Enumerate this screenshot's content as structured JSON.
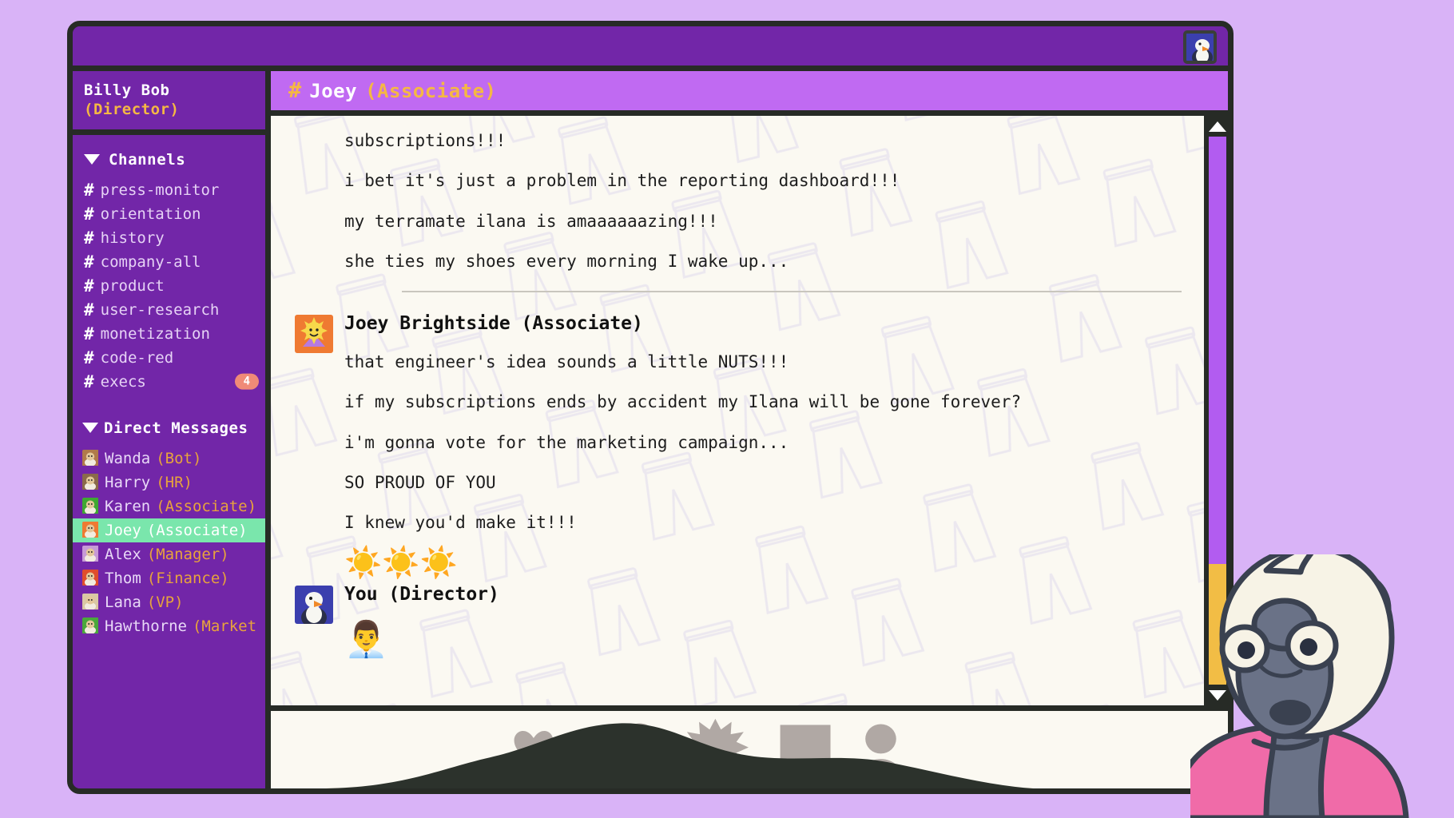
{
  "theme": {
    "page_bg": "#d9b3f7",
    "window_bg": "#7226a8",
    "border": "#272b26",
    "sidebar_purple": "#7226a8",
    "header_purple": "#c06af2",
    "accent_orange": "#f5b843",
    "active_green": "#7ae6ac",
    "badge_coral": "#f08a77",
    "message_bg": "#fbf9f2",
    "scrollbar_thumb": "#b25cf0",
    "scrollbar_thumb_alt": "#f2bd45"
  },
  "titlebar": {
    "avatar_icon": "seagull-avatar-icon"
  },
  "sidebar": {
    "user": {
      "name": "Billy Bob",
      "role": "(Director)"
    },
    "channels_section": {
      "label": "Channels",
      "caret_icon": "caret-down-icon",
      "items": [
        {
          "hash": "#",
          "name": "press-monitor",
          "badge": ""
        },
        {
          "hash": "#",
          "name": "orientation",
          "badge": ""
        },
        {
          "hash": "#",
          "name": "history",
          "badge": ""
        },
        {
          "hash": "#",
          "name": "company-all",
          "badge": ""
        },
        {
          "hash": "#",
          "name": "product",
          "badge": ""
        },
        {
          "hash": "#",
          "name": "user-research",
          "badge": ""
        },
        {
          "hash": "#",
          "name": "monetization",
          "badge": ""
        },
        {
          "hash": "#",
          "name": "code-red",
          "badge": ""
        },
        {
          "hash": "#",
          "name": "execs",
          "badge": "4"
        }
      ]
    },
    "dm_section": {
      "label": "Direct Messages",
      "caret_icon": "caret-down-icon",
      "items": [
        {
          "name": "Wanda",
          "role": "(Bot)",
          "avatar_icon": "wanda-avatar-icon",
          "avatar_bg": "#b07a4a",
          "active": false
        },
        {
          "name": "Harry",
          "role": "(HR)",
          "avatar_icon": "harry-avatar-icon",
          "avatar_bg": "#8a6a4a",
          "active": false
        },
        {
          "name": "Karen",
          "role": "(Associate)",
          "avatar_icon": "karen-avatar-icon",
          "avatar_bg": "#3fa832",
          "active": false
        },
        {
          "name": "Joey",
          "role": "(Associate)",
          "avatar_icon": "joey-avatar-icon",
          "avatar_bg": "#ef7a32",
          "active": true
        },
        {
          "name": "Alex",
          "role": "(Manager)",
          "avatar_icon": "alex-avatar-icon",
          "avatar_bg": "#c79ad6",
          "active": false
        },
        {
          "name": "Thom",
          "role": "(Finance)",
          "avatar_icon": "thom-avatar-icon",
          "avatar_bg": "#e04d2c",
          "active": false
        },
        {
          "name": "Lana",
          "role": "(VP)",
          "avatar_icon": "lana-avatar-icon",
          "avatar_bg": "#d9c8a4",
          "active": false
        },
        {
          "name": "Hawthorne",
          "role": "(Market",
          "avatar_icon": "hawthorne-avatar-icon",
          "avatar_bg": "#4aa83c",
          "active": false
        }
      ]
    }
  },
  "channel_header": {
    "hash": "#",
    "name": "Joey",
    "role": "(Associate)"
  },
  "conversation": {
    "leading_lines": [
      "subscriptions!!!",
      "i bet it's just a problem in the reporting dashboard!!!",
      "my terramate ilana is amaaaaaazing!!!",
      "she ties my shoes every morning I wake up..."
    ],
    "blocks": [
      {
        "author": "Joey Brightside (Associate)",
        "avatar_icon": "joey-sun-avatar-icon",
        "lines": [
          "that engineer's idea sounds a little NUTS!!!",
          "if my subscriptions ends by accident my Ilana will be gone forever?",
          "i'm gonna vote for the marketing campaign...",
          "SO PROUD OF YOU",
          "I knew you'd make it!!!"
        ],
        "emoji": "☀️☀️☀️"
      },
      {
        "author": "You (Director)",
        "avatar_icon": "seagull-avatar-icon",
        "lines": [],
        "emoji": "👨‍💼"
      }
    ]
  },
  "scrollbar": {
    "up_arrow_icon": "triangle-up-icon",
    "down_arrow_icon": "triangle-down-icon"
  },
  "composer": {
    "icons": [
      "heart-icon",
      "circle-icon",
      "trophy-icon",
      "starburst-icon",
      "square-icon",
      "person-icon"
    ]
  },
  "mascot": {
    "name": "panda-bear-mascot"
  }
}
